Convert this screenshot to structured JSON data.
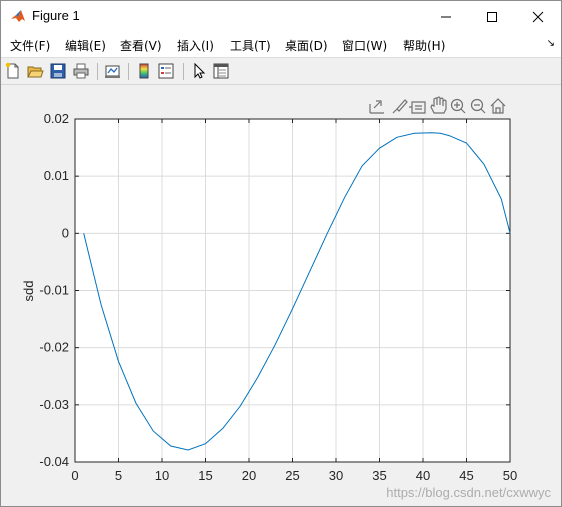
{
  "window": {
    "title": "Figure 1"
  },
  "menubar": {
    "items": [
      {
        "label": "文件(F)"
      },
      {
        "label": "编辑(E)"
      },
      {
        "label": "查看(V)"
      },
      {
        "label": "插入(I)"
      },
      {
        "label": "工具(T)"
      },
      {
        "label": "桌面(D)"
      },
      {
        "label": "窗口(W)"
      },
      {
        "label": "帮助(H)"
      }
    ]
  },
  "toolbar": {
    "icons": [
      "new-figure-icon",
      "open-file-icon",
      "save-icon",
      "print-icon",
      "link-plot-icon",
      "insert-colorbar-icon",
      "insert-legend-icon",
      "edit-plot-icon",
      "property-inspector-icon"
    ]
  },
  "axes_toolbar": {
    "icons": [
      "export-icon",
      "brush-icon",
      "data-tips-icon",
      "pan-icon",
      "zoom-in-icon",
      "zoom-out-icon",
      "home-icon"
    ]
  },
  "chart_data": {
    "type": "line",
    "ylabel": "sdd",
    "xlim": [
      0,
      50
    ],
    "ylim": [
      -0.04,
      0.02
    ],
    "grid": true,
    "xticks": [
      0,
      5,
      10,
      15,
      20,
      25,
      30,
      35,
      40,
      45,
      50
    ],
    "yticks": [
      0.02,
      0.01,
      0,
      -0.01,
      -0.02,
      -0.03,
      -0.04
    ],
    "xtick_labels": [
      "0",
      "5",
      "10",
      "15",
      "20",
      "25",
      "30",
      "35",
      "40",
      "45",
      "50"
    ],
    "ytick_labels": [
      "0.02",
      "0.01",
      "0",
      "-0.01",
      "-0.02",
      "-0.03",
      "-0.04"
    ],
    "series": [
      {
        "color": "#0072BD",
        "x": [
          1,
          3,
          5,
          7,
          9,
          11,
          13,
          15,
          17,
          19,
          21,
          23,
          25,
          27,
          29,
          31,
          33,
          35,
          37,
          39,
          41,
          42,
          43,
          45,
          47,
          49,
          50
        ],
        "y": [
          0.0,
          -0.0125,
          -0.0224,
          -0.0297,
          -0.0346,
          -0.0372,
          -0.0379,
          -0.0368,
          -0.0341,
          -0.0302,
          -0.0252,
          -0.0195,
          -0.0132,
          -0.0066,
          0.0,
          0.0063,
          0.0118,
          0.0149,
          0.0168,
          0.0175,
          0.0176,
          0.0175,
          0.0171,
          0.0158,
          0.0121,
          0.006,
          0.0
        ]
      }
    ]
  },
  "watermark": "https://blog.csdn.net/cxwwyc"
}
